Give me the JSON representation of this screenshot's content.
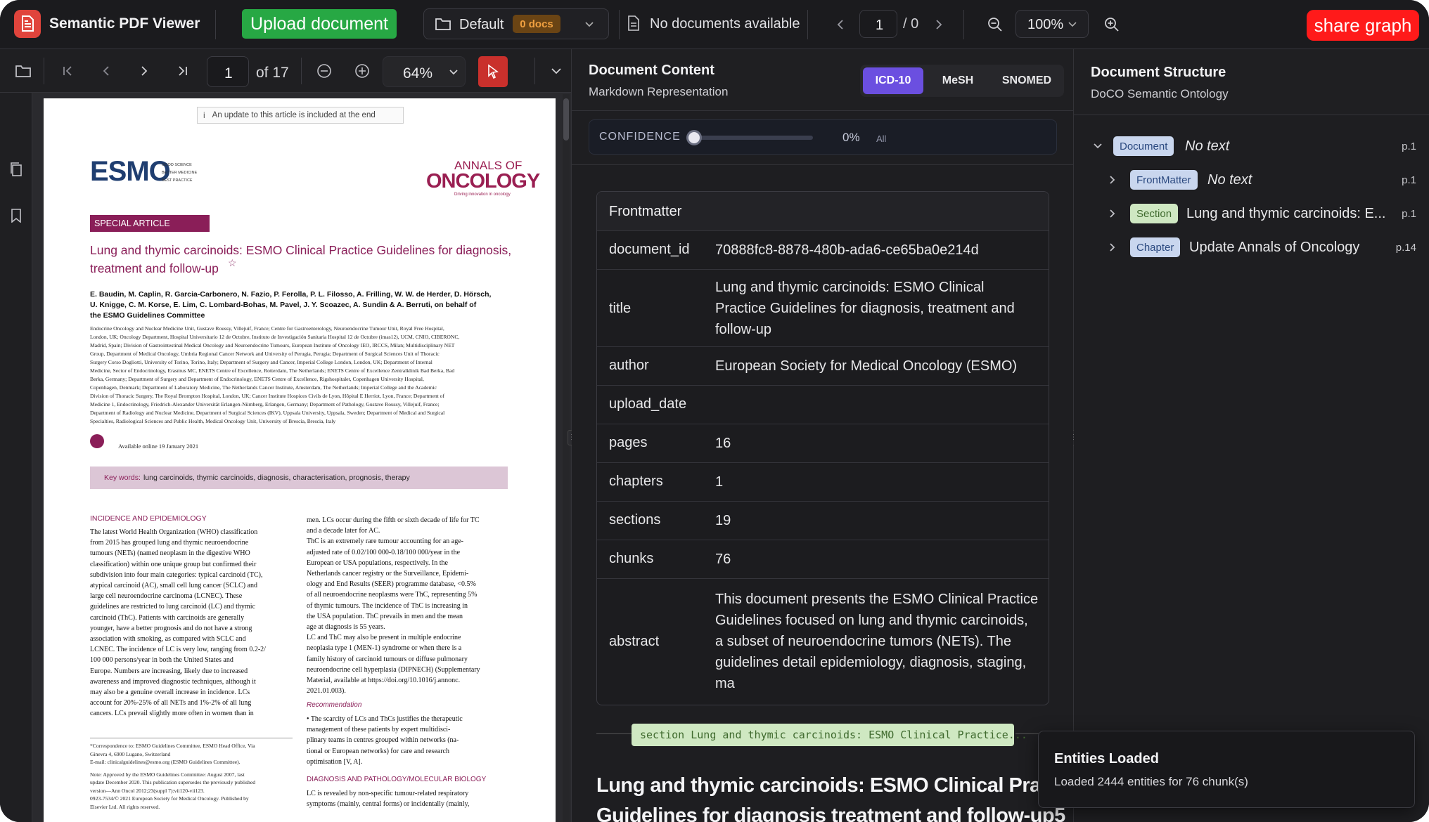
{
  "app": {
    "title": "Semantic PDF Viewer"
  },
  "header": {
    "upload_label": "Upload document",
    "collection": {
      "name": "Default",
      "badge": "0 docs"
    },
    "documents_status": "No documents available",
    "page_current": "1",
    "page_total": "/ 0",
    "zoom": "100%",
    "share_label": "share graph"
  },
  "pdf_toolbar": {
    "page_current": "1",
    "page_total": "of 17",
    "zoom": "64%"
  },
  "pdf_page": {
    "update_notice": "An update to this article is included at the end",
    "logo_esmo": "ESMO",
    "esmo_tagline": [
      "GOOD SCIENCE",
      "BETTER MEDICINE",
      "BEST PRACTICE"
    ],
    "journal_small": "ANNALS OF",
    "journal_big": "ONCOLOGY",
    "journal_tag": "Driving innovation in oncology",
    "banner": "SPECIAL ARTICLE",
    "title_line1": "Lung and thymic carcinoids: ESMO Clinical Practice Guidelines for diagnosis,",
    "title_line2": "treatment and follow-up",
    "authors": [
      "E. Baudin, M. Caplin, R. Garcia-Carbonero, N. Fazio, P. Ferolla, P. L. Filosso, A. Frilling, W. W. de Herder, D. Hörsch,",
      "U. Knigge, C. M. Korse, E. Lim, C. Lombard-Bohas, M. Pavel, J. Y. Scoazec, A. Sundin & A. Berruti, on behalf of",
      "the ESMO Guidelines Committee"
    ],
    "affiliations": [
      "Endocrine Oncology and Nuclear Medicine Unit, Gustave Roussy, Villejuif, France; Centre for Gastroenterology, Neuroendocrine Tumour Unit, Royal Free Hospital,",
      "London, UK; Oncology Department, Hospital Universitario 12 de Octubre, Instituto de Investigación Sanitaria Hospital 12 de Octubre (imas12), UCM, CNIO, CIBERONC,",
      "Madrid, Spain; Division of Gastrointestinal Medical Oncology and Neuroendocrine Tumours, European Institute of Oncology IEO, IRCCS, Milan; Multidisciplinary NET",
      "Group, Department of Medical Oncology, Umbria Regional Cancer Network and University of Perugia, Perugia; Department of Surgical Sciences Unit of Thoracic",
      "Surgery Corso Dogliotti, University of Torino, Torino, Italy; Department of Surgery and Cancer, Imperial College London, London, UK; Department of Internal",
      "Medicine, Sector of Endocrinology, Erasmus MC, ENETS Centre of Excellence, Rotterdam, The Netherlands; ENETS Centre of Excellence Zentralklinik Bad Berka, Bad",
      "Berka, Germany; Department of Surgery and Department of Endocrinology, ENETS Centre of Excellence, Rigshospitalet, Copenhagen University Hospital,",
      "Copenhagen, Denmark; Department of Laboratory Medicine, The Netherlands Cancer Institute, Amsterdam, The Netherlands; Imperial College and the Academic",
      "Division of Thoracic Surgery, The Royal Brompton Hospital, London, UK; Cancer Institute Hospices Civils de Lyon, Hôpital E Herriot, Lyon, France; Department of",
      "Medicine 1, Endocrinology, Friedrich-Alexander Universität Erlangen-Nürnberg, Erlangen, Germany; Department of Pathology, Gustave Roussy, Villejuif, France;",
      "Department of Radiology and Nuclear Medicine, Department of Surgical Sciences (IKV), Uppsala University, Uppsala, Sweden; Department of Medical and Surgical",
      "Specialties, Radiological Sciences and Public Health, Medical Oncology Unit, University of Brescia, Brescia, Italy"
    ],
    "available_online": "Available online 19 January 2021",
    "keywords_label": "Key words:",
    "keywords": "lung carcinoids, thymic carcinoids, diagnosis, characterisation, prognosis, therapy",
    "section_heading": "INCIDENCE AND EPIDEMIOLOGY",
    "col1": [
      "The latest World Health Organization (WHO) classification",
      "from 2015 has grouped lung and thymic neuroendocrine",
      "tumours (NETs) (named neoplasm in the digestive WHO",
      "classification) within one unique group but confirmed their",
      "subdivision into four main categories: typical carcinoid (TC),",
      "atypical carcinoid (AC), small cell lung cancer (SCLC) and",
      "large cell neuroendocrine carcinoma (LCNEC). These",
      "guidelines are restricted to lung carcinoid (LC) and thymic",
      "carcinoid (ThC). Patients with carcinoids are generally",
      "younger, have a better prognosis and do not have a strong",
      "association with smoking, as compared with SCLC and",
      "LCNEC. The incidence of LC is very low, ranging from 0.2-2/",
      "100 000 persons/year in both the United States and",
      "Europe. Numbers are increasing, likely due to increased",
      "awareness and improved diagnostic techniques, although it",
      "may also be a genuine overall increase in incidence. LCs",
      "account for 20%-25% of all NETs and 1%-2% of all lung",
      "cancers. LCs prevail slightly more often in women than in"
    ],
    "col2": [
      "men. LCs occur during the fifth or sixth decade of life for TC",
      "and a decade later for AC.",
      "ThC is an extremely rare tumour accounting for an age-",
      "adjusted rate of 0.02/100 000-0.18/100 000/year in the",
      "European or USA populations, respectively. In the",
      "Netherlands cancer registry or the Surveillance, Epidemi-",
      "ology and End Results (SEER) programme database, <0.5%",
      "of all neuroendocrine neoplasms were ThC, representing 5%",
      "of thymic tumours. The incidence of ThC is increasing in",
      "the USA population. ThC prevails in men and the mean",
      "age at diagnosis is 55 years.",
      "LC and ThC may also be present in multiple endocrine",
      "neoplasia type 1 (MEN-1) syndrome or when there is a",
      "family history of carcinoid tumours or diffuse pulmonary",
      "neuroendocrine cell hyperplasia (DIPNECH) (Supplementary",
      "Material, available at https://doi.org/10.1016/j.annonc.",
      "2021.01.003)."
    ],
    "recommendation_heading": "Recommendation",
    "recommendation": [
      "The scarcity of LCs and ThCs justifies the therapeutic",
      "management of these patients by expert multidisci-",
      "plinary teams in centres grouped within networks (na-",
      "tional or European networks) for care and research",
      "optimisation [V, A]."
    ],
    "section2_heading": "DIAGNOSIS AND PATHOLOGY/MOLECULAR BIOLOGY",
    "col2_end": [
      "LC is revealed by non-specific tumour-related respiratory",
      "symptoms (mainly, central forms) or incidentally (mainly,"
    ],
    "footnotes": [
      "*Correspondence to: ESMO Guidelines Committee, ESMO Head Office, Via",
      "Ginevra 4, 6900 Lugano, Switzerland",
      "E-mail: clinicalguidelines@esmo.org (ESMO Guidelines Committee).",
      "",
      "Note: Approved by the ESMO Guidelines Committee: August 2007, last",
      "update December 2020. This publication supersedes the previously published",
      "version—Ann Oncol 2012;23(suppl 7):vii120-vii123.",
      "0923-7534/© 2021 European Society for Medical Oncology. Published by",
      "Elsevier Ltd. All rights reserved."
    ]
  },
  "content_panel": {
    "title": "Document Content",
    "subtitle": "Markdown Representation",
    "tabs": [
      "ICD-10",
      "MeSH",
      "SNOMED"
    ],
    "active_tab": "ICD-10",
    "confidence": {
      "label": "CONFIDENCE",
      "value": "0%",
      "scope": "All",
      "fraction": 0
    },
    "table_header": "Frontmatter",
    "rows": [
      {
        "key": "document_id",
        "value": "70888fc8-8878-480b-ada6-ce65ba0e214d"
      },
      {
        "key": "title",
        "value": "Lung and thymic carcinoids: ESMO Clinical Practice Guidelines for diagnosis, treatment and follow-up"
      },
      {
        "key": "author",
        "value": "European Society for Medical Oncology (ESMO)"
      },
      {
        "key": "upload_date",
        "value": ""
      },
      {
        "key": "pages",
        "value": "16"
      },
      {
        "key": "chapters",
        "value": "1"
      },
      {
        "key": "sections",
        "value": "19"
      },
      {
        "key": "chunks",
        "value": "76"
      },
      {
        "key": "abstract",
        "value": "This document presents the ESMO Clinical Practice Guidelines focused on lung and thymic carcinoids, a subset of neuroendocrine tumors (NETs). The guidelines detail epidemiology, diagnosis, staging, ma"
      }
    ],
    "section_tag": "section Lung and thymic carcinoids: ESMO Clinical Practice...",
    "heading_line1": "Lung and thymic carcinoids: ESMO Clinical Practice",
    "heading_line2": "Guidelines for diagnosis treatment and follow-up5"
  },
  "structure_panel": {
    "title": "Document Structure",
    "subtitle": "DoCO Semantic Ontology",
    "nodes": [
      {
        "type": "Document",
        "text": "No text",
        "page": "p.1"
      },
      {
        "type": "FrontMatter",
        "text": "No text",
        "page": "p.1"
      },
      {
        "type": "Section",
        "text": "Lung and thymic carcinoids: E...",
        "page": "p.1"
      },
      {
        "type": "Chapter",
        "text": "Update Annals of Oncology",
        "page": "p.14"
      }
    ]
  },
  "toast": {
    "title": "Entities Loaded",
    "message": "Loaded 2444 entities for 76 chunk(s)"
  },
  "colors": {
    "accent_green": "#27a844",
    "share_red": "#ff1a1a",
    "tab_active": "#6b4fe0",
    "pdf_magenta": "#8a1e58"
  }
}
